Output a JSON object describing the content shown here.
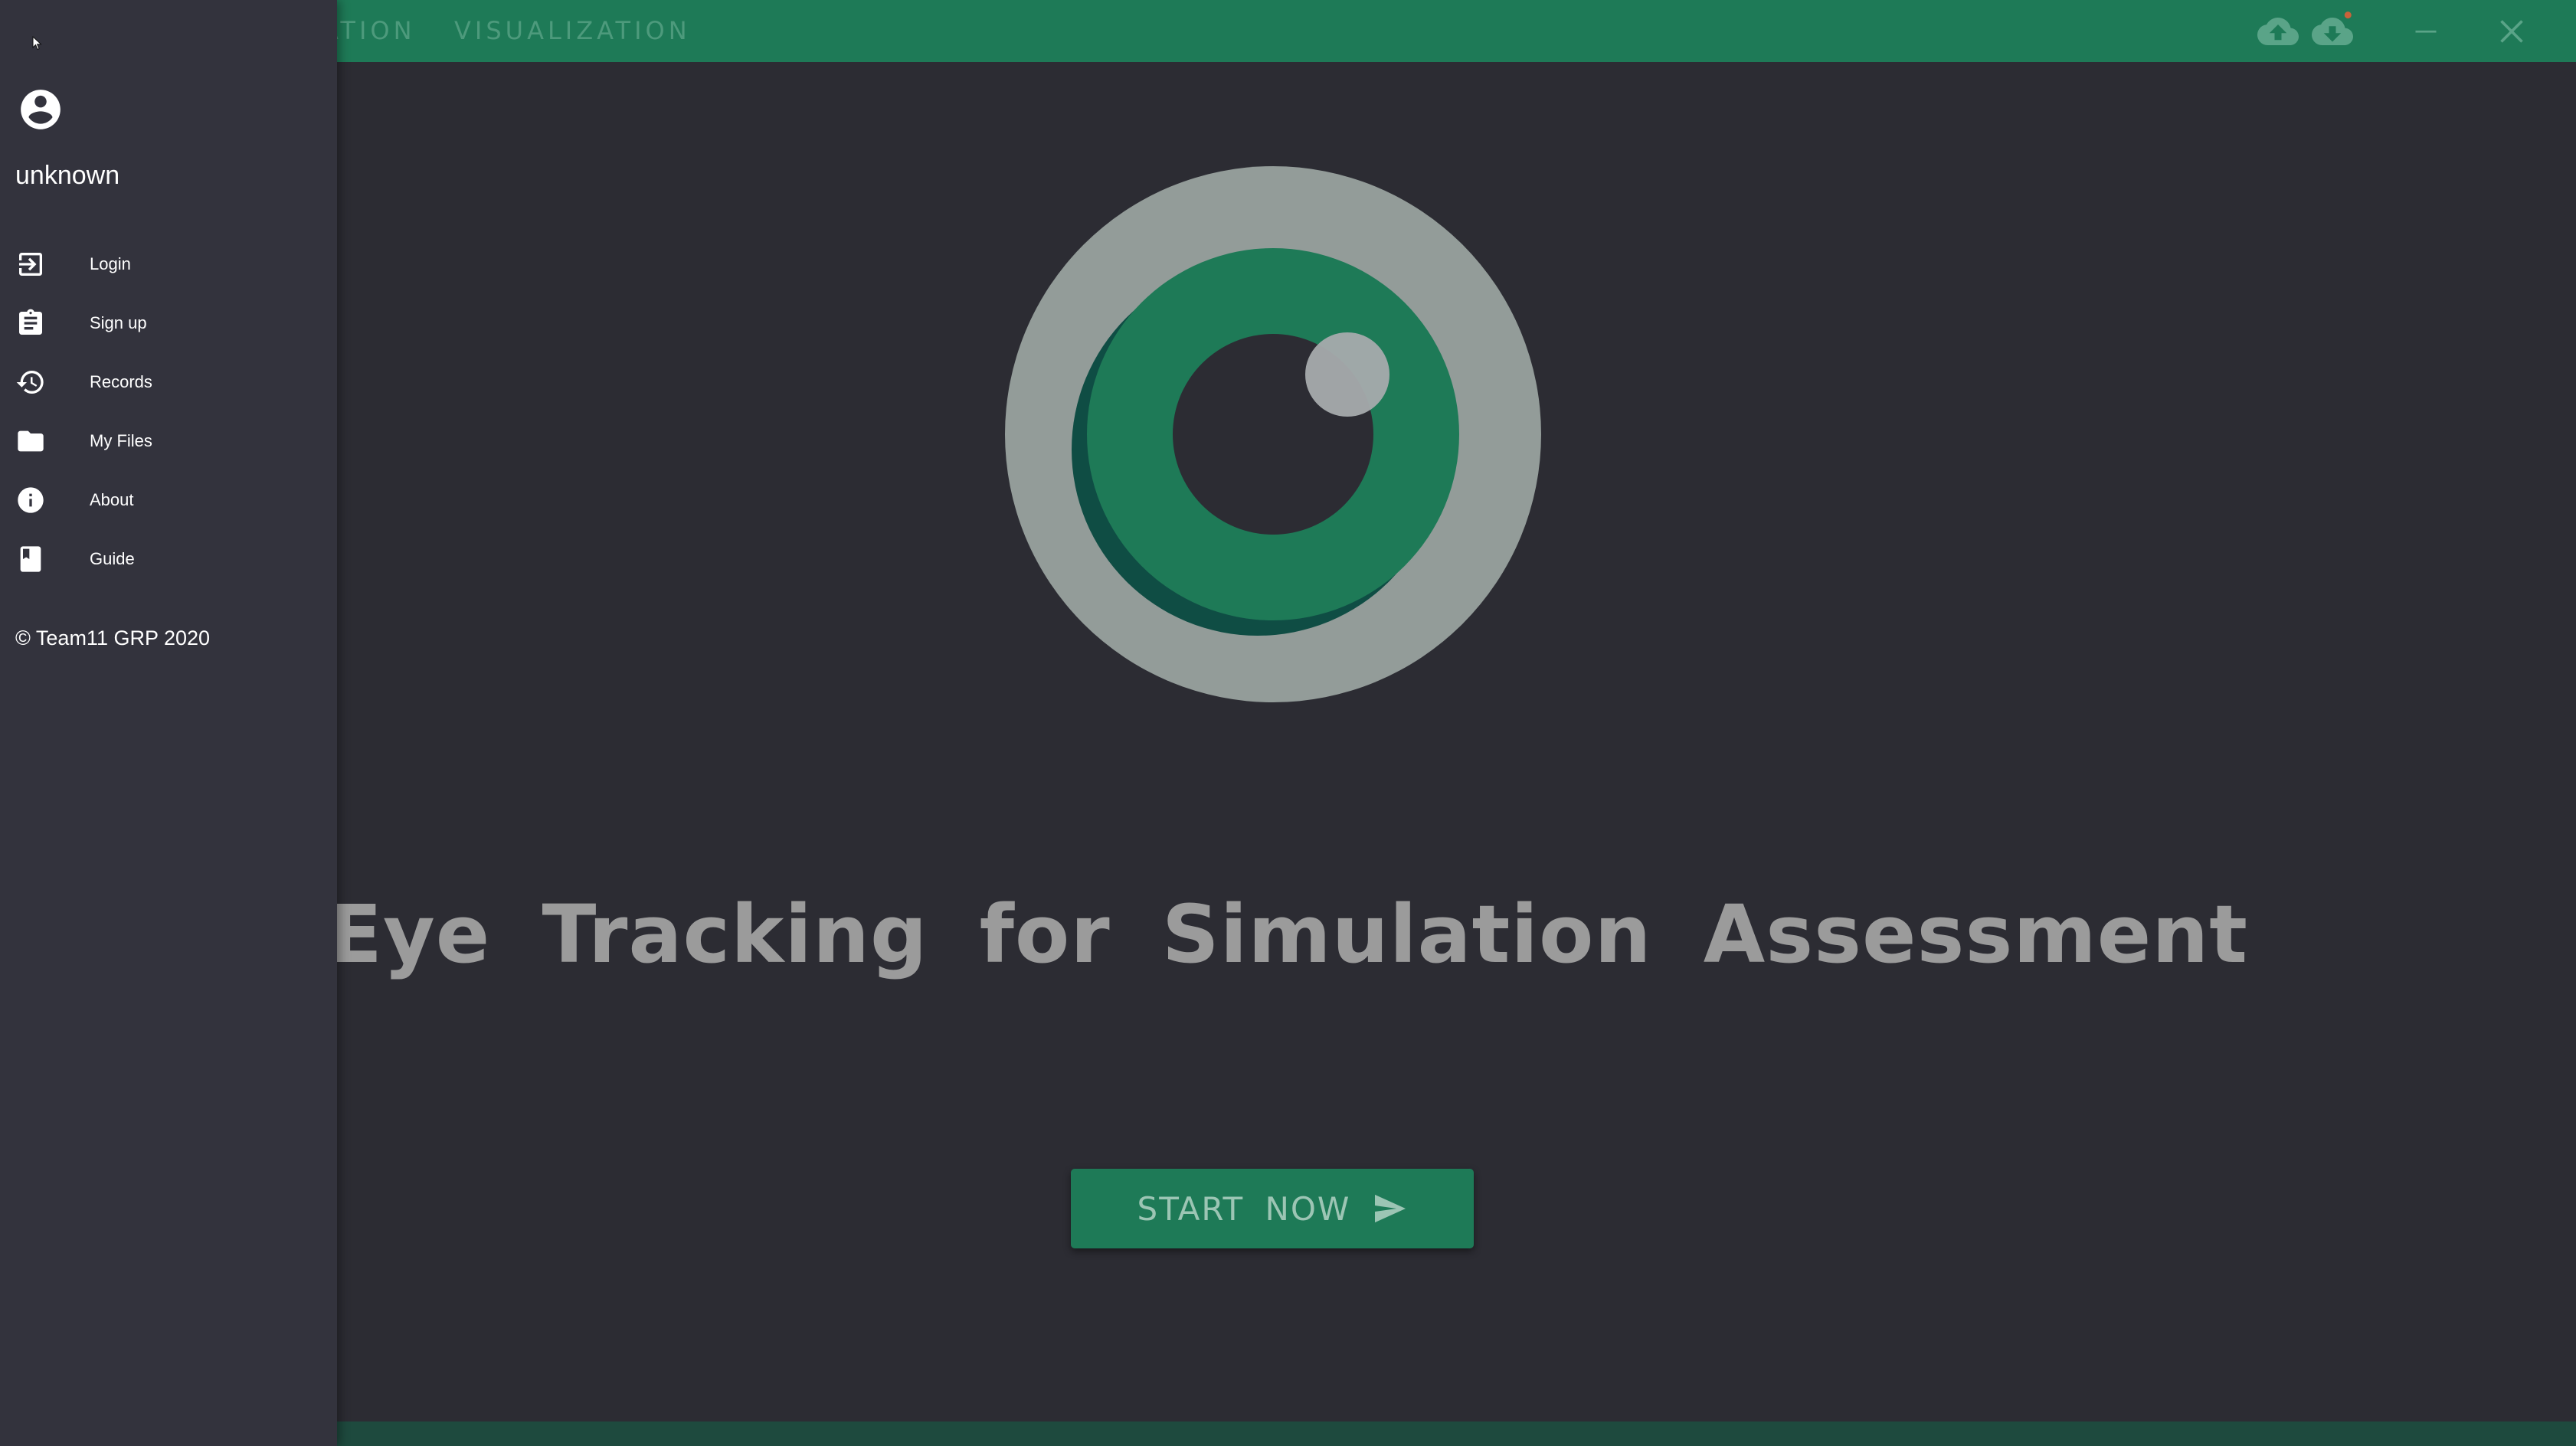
{
  "tabs": [
    {
      "label": "ATION"
    },
    {
      "label": "VISUALIZATION"
    }
  ],
  "window_controls": {
    "upload_icon": "cloud-upload-icon",
    "download_icon": "cloud-download-icon",
    "minimize_icon": "minimize-icon",
    "close_icon": "close-icon"
  },
  "sidebar": {
    "username": "unknown",
    "items": [
      {
        "label": "Login",
        "icon": "login-icon"
      },
      {
        "label": "Sign up",
        "icon": "clipboard-icon"
      },
      {
        "label": "Records",
        "icon": "history-icon"
      },
      {
        "label": "My Files",
        "icon": "folder-icon"
      },
      {
        "label": "About",
        "icon": "info-icon"
      },
      {
        "label": "Guide",
        "icon": "book-icon"
      }
    ],
    "copyright": "© Team11 GRP 2020"
  },
  "main": {
    "title": "Eye Tracking for Simulation Assessment",
    "start_button": "START NOW"
  },
  "colors": {
    "accent": "#1e7a57",
    "background": "#2c2c33",
    "sidebar": "#33333d",
    "logo_ring": "#939c99"
  }
}
